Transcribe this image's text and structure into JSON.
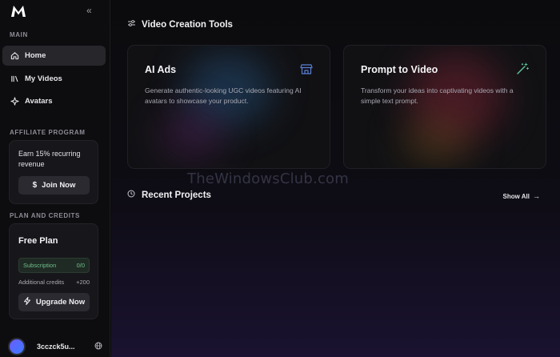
{
  "sidebar": {
    "section_main": "MAIN",
    "nav": [
      {
        "label": "Home",
        "icon": "home-icon",
        "active": true
      },
      {
        "label": "My Videos",
        "icon": "library-icon",
        "active": false
      },
      {
        "label": "Avatars",
        "icon": "sparkle-icon",
        "active": false
      }
    ],
    "section_affiliate": "AFFILIATE PROGRAM",
    "affiliate": {
      "text": "Earn 15% recurring revenue",
      "button": "Join Now",
      "button_icon": "dollar-icon"
    },
    "section_plan": "PLAN AND CREDITS",
    "plan": {
      "title": "Free Plan",
      "subscription_label": "Subscription",
      "subscription_value": "0/0",
      "credits_label": "Additional credits",
      "credits_value": "+200",
      "upgrade_button": "Upgrade Now",
      "upgrade_icon": "bolt-icon"
    },
    "user": {
      "name": "3cczck5u..."
    }
  },
  "main": {
    "tools_heading": "Video Creation Tools",
    "tools": [
      {
        "title": "AI Ads",
        "description": "Generate authentic-looking UGC videos featuring AI avatars to showcase your product.",
        "icon": "store-icon"
      },
      {
        "title": "Prompt to Video",
        "description": "Transform your ideas into captivating videos with a simple text prompt.",
        "icon": "magic-wand-icon"
      }
    ],
    "recent_heading": "Recent Projects",
    "show_all": "Show All"
  },
  "watermark": "TheWindowsClub.com",
  "colors": {
    "accent_green": "#6fbf8a",
    "background": "#0b0b0d",
    "card": "#111114"
  }
}
